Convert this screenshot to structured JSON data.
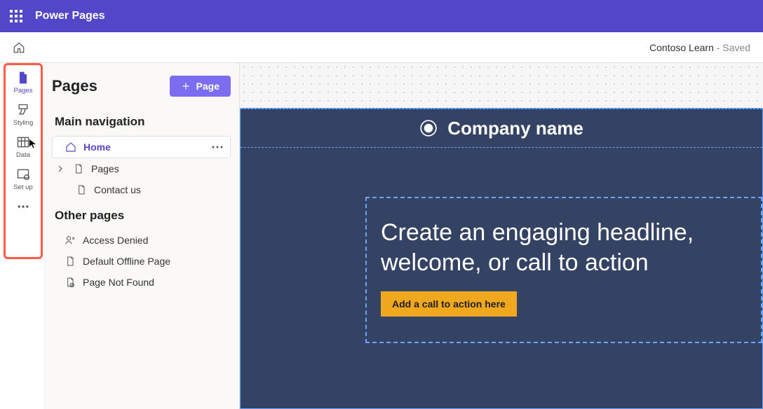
{
  "topbar": {
    "brand": "Power Pages"
  },
  "subbar": {
    "site_name": "Contoso Learn",
    "saved_suffix": " - Saved"
  },
  "rail": {
    "items": [
      {
        "label": "Pages"
      },
      {
        "label": "Styling"
      },
      {
        "label": "Data"
      },
      {
        "label": "Set up"
      }
    ]
  },
  "panel": {
    "title": "Pages",
    "add_label": "Page",
    "section_main": "Main navigation",
    "section_other": "Other pages",
    "main_items": [
      {
        "label": "Home"
      },
      {
        "label": "Pages"
      },
      {
        "label": "Contact us"
      }
    ],
    "other_items": [
      {
        "label": "Access Denied"
      },
      {
        "label": "Default Offline Page"
      },
      {
        "label": "Page Not Found"
      }
    ]
  },
  "preview": {
    "company_name": "Company name",
    "hero_line1": "Create an engaging headline,",
    "hero_line2": "welcome, or call to action",
    "cta": "Add a call to action here"
  }
}
